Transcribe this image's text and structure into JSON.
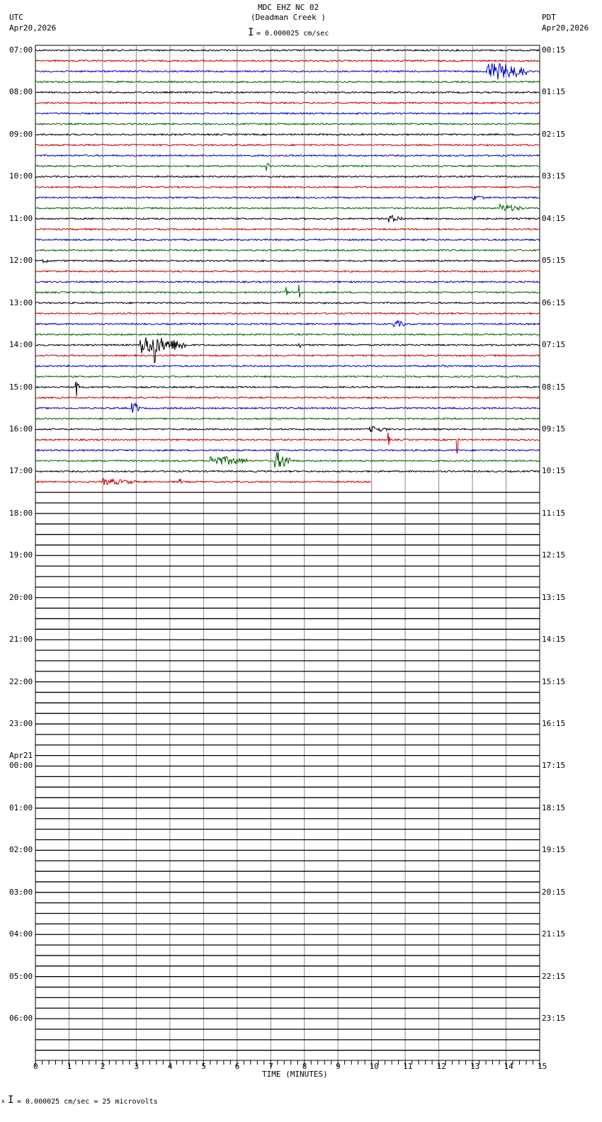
{
  "header": {
    "title": "MDC EHZ NC 02",
    "subtitle": "(Deadman Creek )",
    "left_tz": "UTC",
    "left_date": "Apr20,2026",
    "right_tz": "PDT",
    "right_date": "Apr20,2026",
    "scale": "= 0.000025 cm/sec"
  },
  "footer": {
    "scale": "= 0.000025 cm/sec =      25 microvolts",
    "prefix": "x"
  },
  "chart_data": {
    "type": "line",
    "title": "MDC EHZ NC 02 (Deadman Creek )",
    "xlabel": "TIME (MINUTES)",
    "xlim": [
      0,
      15
    ],
    "x_ticks": [
      "0",
      "1",
      "2",
      "3",
      "4",
      "5",
      "6",
      "7",
      "8",
      "9",
      "10",
      "11",
      "12",
      "13",
      "14",
      "15"
    ],
    "rows_total": 96,
    "rows_with_data": 42,
    "last_row_end_minute": 10,
    "colors": [
      "#000000",
      "#cc0000",
      "#0000cc",
      "#006600"
    ],
    "left_labels": [
      {
        "row": 0,
        "text": "07:00"
      },
      {
        "row": 4,
        "text": "08:00"
      },
      {
        "row": 8,
        "text": "09:00"
      },
      {
        "row": 12,
        "text": "10:00"
      },
      {
        "row": 16,
        "text": "11:00"
      },
      {
        "row": 20,
        "text": "12:00"
      },
      {
        "row": 24,
        "text": "13:00"
      },
      {
        "row": 28,
        "text": "14:00"
      },
      {
        "row": 32,
        "text": "15:00"
      },
      {
        "row": 36,
        "text": "16:00"
      },
      {
        "row": 40,
        "text": "17:00"
      },
      {
        "row": 44,
        "text": "18:00"
      },
      {
        "row": 48,
        "text": "19:00"
      },
      {
        "row": 52,
        "text": "20:00"
      },
      {
        "row": 56,
        "text": "21:00"
      },
      {
        "row": 60,
        "text": "22:00"
      },
      {
        "row": 64,
        "text": "23:00"
      },
      {
        "row": 68,
        "text": "00:00",
        "date": "Apr21"
      },
      {
        "row": 72,
        "text": "01:00"
      },
      {
        "row": 76,
        "text": "02:00"
      },
      {
        "row": 80,
        "text": "03:00"
      },
      {
        "row": 84,
        "text": "04:00"
      },
      {
        "row": 88,
        "text": "05:00"
      },
      {
        "row": 92,
        "text": "06:00"
      }
    ],
    "right_labels": [
      "00:15",
      "01:15",
      "02:15",
      "03:15",
      "04:15",
      "05:15",
      "06:15",
      "07:15",
      "08:15",
      "09:15",
      "10:15",
      "11:15",
      "12:15",
      "13:15",
      "14:15",
      "15:15",
      "16:15",
      "17:15",
      "18:15",
      "19:15",
      "20:15",
      "21:15",
      "22:15",
      "23:15"
    ],
    "events": [
      {
        "row": 2,
        "start": 13.4,
        "end": 14.6,
        "amp": 14
      },
      {
        "row": 11,
        "start": 6.85,
        "end": 6.95,
        "amp": 8
      },
      {
        "row": 14,
        "start": 13.0,
        "end": 13.5,
        "amp": 4
      },
      {
        "row": 15,
        "start": 13.8,
        "end": 14.5,
        "amp": 6
      },
      {
        "row": 16,
        "start": 10.5,
        "end": 10.95,
        "amp": 6
      },
      {
        "row": 20,
        "start": 0.2,
        "end": 0.5,
        "amp": 3
      },
      {
        "row": 23,
        "start": 7.42,
        "end": 7.5,
        "amp": 20
      },
      {
        "row": 23,
        "start": 7.82,
        "end": 7.88,
        "amp": 26
      },
      {
        "row": 26,
        "start": 10.65,
        "end": 11.0,
        "amp": 6
      },
      {
        "row": 28,
        "start": 3.1,
        "end": 4.5,
        "amp": 14
      },
      {
        "row": 28,
        "start": 3.52,
        "end": 3.6,
        "amp": 50
      },
      {
        "row": 28,
        "start": 7.82,
        "end": 7.88,
        "amp": 16
      },
      {
        "row": 30,
        "start": 12.1,
        "end": 12.3,
        "amp": 3
      },
      {
        "row": 32,
        "start": 1.2,
        "end": 1.3,
        "amp": 18
      },
      {
        "row": 34,
        "start": 2.85,
        "end": 3.1,
        "amp": 10
      },
      {
        "row": 36,
        "start": 9.9,
        "end": 10.5,
        "amp": 5
      },
      {
        "row": 37,
        "start": 10.48,
        "end": 10.55,
        "amp": 12
      },
      {
        "row": 37,
        "start": 12.52,
        "end": 12.58,
        "amp": 30
      },
      {
        "row": 39,
        "start": 5.2,
        "end": 6.3,
        "amp": 8
      },
      {
        "row": 39,
        "start": 7.1,
        "end": 7.6,
        "amp": 14
      },
      {
        "row": 41,
        "start": 2.0,
        "end": 3.0,
        "amp": 5
      },
      {
        "row": 41,
        "start": 4.25,
        "end": 4.35,
        "amp": 8
      }
    ]
  }
}
